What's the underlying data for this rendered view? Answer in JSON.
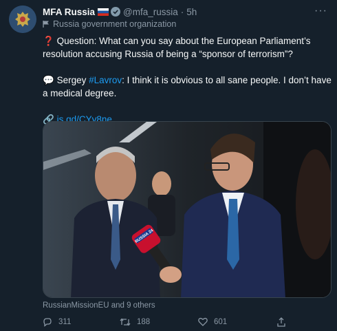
{
  "author": {
    "name": "MFA Russia",
    "handle": "@mfa_russia",
    "separator": "·",
    "time": "5h",
    "label": "Russia government organization"
  },
  "tweet": {
    "q_prefix": "Question: What can you say about the European Parliament’s resolution accusing Russia of being a “sponsor of terrorism”?",
    "a_prefix": "Sergey ",
    "a_hashtag": "#Lavrov",
    "a_rest": ": I think it is obvious to all sane people. I don’t have a medical degree.",
    "link": "is.gd/CYy8ne"
  },
  "media": {
    "mic_label": "RUSSIA 24"
  },
  "tagged": "RussianMissionEU and 9 others",
  "stats": {
    "replies": "311",
    "retweets": "188",
    "likes": "601"
  },
  "colors": {
    "background": "#15202b",
    "text": "#f7f9f9",
    "muted": "#8b98a5",
    "link": "#1d9bf0"
  }
}
